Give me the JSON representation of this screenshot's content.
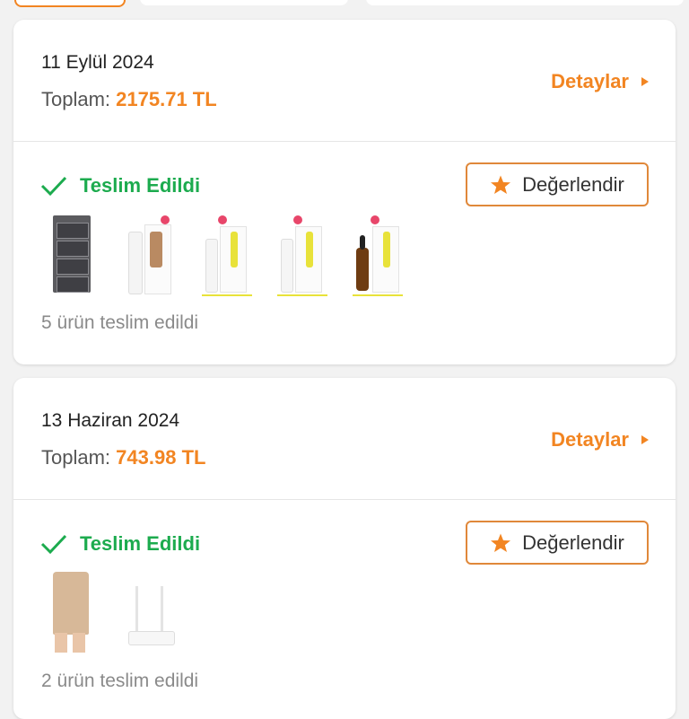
{
  "orders": [
    {
      "date": "11 Eylül 2024",
      "total_label": "Toplam:",
      "total_amount": "2175.71 TL",
      "details_label": "Detaylar",
      "status": "Teslim Edildi",
      "rate_label": "Değerlendir",
      "delivered_text": "5 ürün teslim edildi",
      "products": [
        {
          "kind": "storage-shelf"
        },
        {
          "kind": "pump-bottle-with-box"
        },
        {
          "kind": "spray-bottle-with-box"
        },
        {
          "kind": "spray-bottle-with-box"
        },
        {
          "kind": "dropper-serum-with-box"
        }
      ]
    },
    {
      "date": "13 Haziran 2024",
      "total_label": "Toplam:",
      "total_amount": "743.98 TL",
      "details_label": "Detaylar",
      "status": "Teslim Edildi",
      "rate_label": "Değerlendir",
      "delivered_text": "2 ürün teslim edildi",
      "products": [
        {
          "kind": "beige-shapewear-skirt"
        },
        {
          "kind": "white-wifi-router"
        }
      ]
    }
  ],
  "icons": {
    "check": "check-icon",
    "star": "star-icon",
    "chevron": "chevron-right-icon"
  },
  "colors": {
    "accent": "#f28522",
    "success": "#1cab4e",
    "muted": "#8a8a8a"
  }
}
